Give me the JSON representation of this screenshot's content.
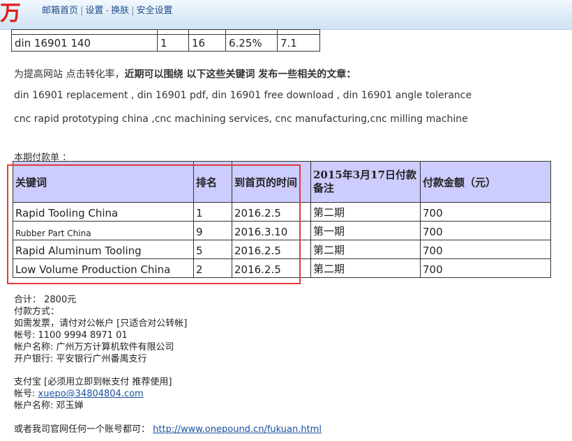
{
  "header": {
    "logo_text": "万",
    "nav": [
      "邮箱首页",
      "设置",
      "换肤",
      "安全设置"
    ],
    "separator": "|",
    "dash": "-"
  },
  "prev_table": {
    "row": [
      "din 16901 140",
      "1",
      "16",
      "6.25%",
      "7.1"
    ]
  },
  "paragraphs": {
    "intro_plain": "为提高网站 点击转化率，",
    "intro_bold": "近期可以围绕 以下这些关键词  发布一些相关的文章：",
    "keywords_line1": "din 16901 replacement , din 16901 pdf, din 16901 free download , din 16901 angle tolerance",
    "keywords_line2": "cnc rapid prototyping china ,cnc machining services, cnc manufacturing,cnc milling machine",
    "bill_title": "本期付款单 ："
  },
  "payment_table": {
    "headers": [
      "关键词",
      "排名",
      "到首页的时间",
      "2015年3月17日付款备注",
      "付款金额（元）"
    ],
    "rows": [
      [
        "Rapid Tooling China",
        "1",
        "2016.2.5",
        "第二期",
        "700"
      ],
      [
        "Rubber Part China",
        "9",
        "2016.3.10",
        "第一期",
        "700"
      ],
      [
        "Rapid Aluminum Tooling",
        "5",
        "2016.2.5",
        "第二期",
        "700"
      ],
      [
        "Low Volume Production China",
        "2",
        "2016.2.5",
        "第二期",
        "700"
      ]
    ]
  },
  "payment_info": {
    "total": "合计：  2800元",
    "method": "付款方式：",
    "invoice": "如需发票，请付对公帐户 [只适合对公转帐]",
    "account": "帐号: 1100 9994 8971 01",
    "account_name": "帐户名称: 广州万方计算机软件有限公司",
    "bank": "开户银行: 平安银行广州番禺支行",
    "alipay": "支付宝 [必须用立即到帐支付 推荐使用]",
    "alipay_account_label": "帐号: ",
    "alipay_email": "xuepo@34804804.com",
    "alipay_name": "帐户名称: 邓玉婵",
    "official_label": "或者我司官网任何一个账号都可： ",
    "official_url": "http://www.onepound.cn/fukuan.html"
  },
  "colors": {
    "header_bg": "#ccccff",
    "highlight": "#e53935",
    "logo": "#e11d1d",
    "link": "#1a4fa0"
  }
}
